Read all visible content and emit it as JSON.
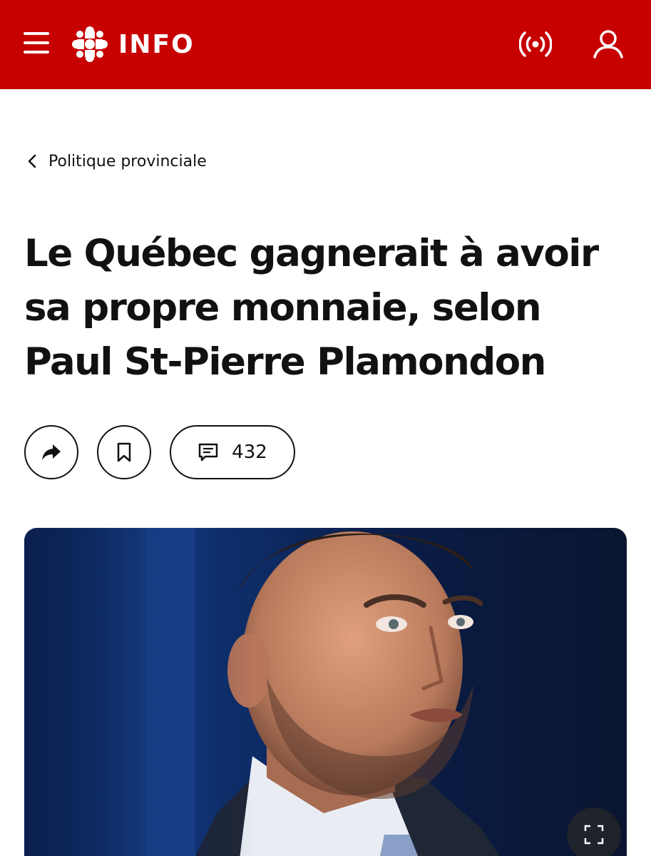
{
  "header": {
    "brand_text": "INFO",
    "brand_color": "#c70000",
    "menu_icon": "hamburger-menu-icon",
    "live_icon": "live-broadcast-icon",
    "account_icon": "user-account-icon"
  },
  "breadcrumb": {
    "label": "Politique provinciale",
    "icon": "chevron-left-icon"
  },
  "article": {
    "title": "Le Québec gagnerait à avoir sa propre monnaie, selon Paul St-Pierre Plamondon"
  },
  "actions": {
    "share_icon": "share-arrow-icon",
    "bookmark_icon": "bookmark-icon",
    "comment_icon": "comment-icon",
    "comment_count": "432"
  },
  "hero": {
    "expand_icon": "fullscreen-expand-icon"
  }
}
